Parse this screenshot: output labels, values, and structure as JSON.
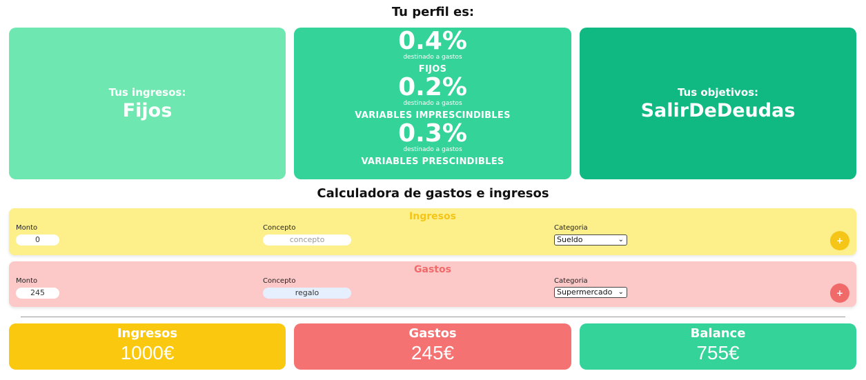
{
  "profile": {
    "title": "Tu perfil es:",
    "income_card": {
      "label": "Tus ingresos:",
      "value": "Fijos"
    },
    "distribution": [
      {
        "percent": "0.4%",
        "sub": "destinado a gastos",
        "category": "FIJOS"
      },
      {
        "percent": "0.2%",
        "sub": "destinado a gastos",
        "category": "VARIABLES IMPRESCINDIBLES"
      },
      {
        "percent": "0.3%",
        "sub": "destinado a gastos",
        "category": "VARIABLES PRESCINDIBLES"
      }
    ],
    "goals_card": {
      "label": "Tus objetivos:",
      "value": "SalirDeDeudas"
    }
  },
  "calculator": {
    "title": "Calculadora de gastos e ingresos",
    "ingresos": {
      "title": "Ingresos",
      "monto_label": "Monto",
      "monto_value": "0",
      "concepto_label": "Concepto",
      "concepto_placeholder": "concepto",
      "categoria_label": "Categoria",
      "categoria_selected": "Sueldo",
      "add_label": "+"
    },
    "gastos": {
      "title": "Gastos",
      "monto_label": "Monto",
      "monto_value": "245",
      "concepto_label": "Concepto",
      "concepto_value": "regalo",
      "categoria_label": "Categoria",
      "categoria_selected": "Supermercado",
      "add_label": "+"
    }
  },
  "summary": {
    "ingresos": {
      "label": "Ingresos",
      "value": "1000€"
    },
    "gastos": {
      "label": "Gastos",
      "value": "245€"
    },
    "balance": {
      "label": "Balance",
      "value": "755€"
    }
  },
  "colors": {
    "income_card": "#6ee7b0",
    "distribution_card": "#34d399",
    "goals_card": "#10b981",
    "ingresos_accent": "#f5c518",
    "gastos_accent": "#f16a6a"
  }
}
